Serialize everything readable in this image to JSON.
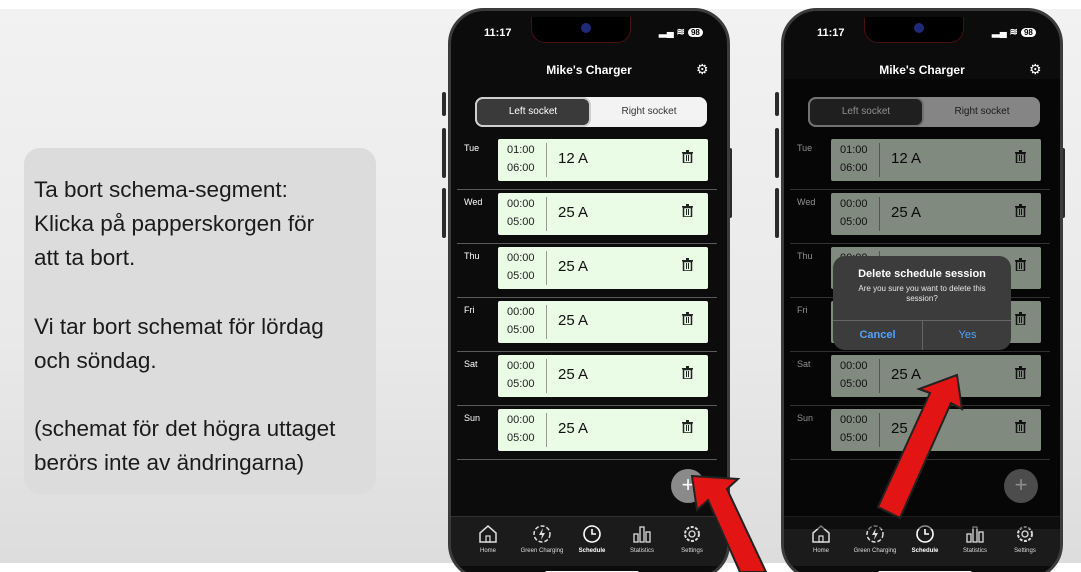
{
  "instructions": {
    "paragraphs": [
      "Ta bort schema-segment:\nKlicka på papperskorgen för\natt ta bort.",
      "Vi tar bort schemat för lördag\noch söndag.",
      "(schemat för det högra uttaget\nberörs inte av ändringarna)"
    ]
  },
  "status": {
    "time": "11:17",
    "battery": "98"
  },
  "app": {
    "title": "Mike's Charger",
    "tabs": {
      "left": "Left socket",
      "right": "Right socket"
    }
  },
  "schedule_left": [
    {
      "day": "Tue",
      "start": "01:00",
      "end": "06:00",
      "amps": "12 A"
    },
    {
      "day": "Wed",
      "start": "00:00",
      "end": "05:00",
      "amps": "25 A"
    },
    {
      "day": "Thu",
      "start": "00:00",
      "end": "05:00",
      "amps": "25 A"
    },
    {
      "day": "Fri",
      "start": "00:00",
      "end": "05:00",
      "amps": "25 A"
    },
    {
      "day": "Sat",
      "start": "00:00",
      "end": "05:00",
      "amps": "25 A"
    },
    {
      "day": "Sun",
      "start": "00:00",
      "end": "05:00",
      "amps": "25 A"
    }
  ],
  "schedule_right": [
    {
      "day": "Tue",
      "start": "01:00",
      "end": "06:00",
      "amps": "12 A"
    },
    {
      "day": "Wed",
      "start": "00:00",
      "end": "05:00",
      "amps": "25 A"
    },
    {
      "day": "Thu",
      "start": "00:00",
      "end": "",
      "amps": ""
    },
    {
      "day": "Fri",
      "start": "",
      "end": "",
      "amps": ""
    },
    {
      "day": "Sat",
      "start": "00:00",
      "end": "05:00",
      "amps": "25 A"
    },
    {
      "day": "Sun",
      "start": "00:00",
      "end": "05:00",
      "amps": "25"
    }
  ],
  "nav": {
    "home": "Home",
    "green": "Green Charging",
    "schedule": "Schedule",
    "statistics": "Statistics",
    "settings": "Settings"
  },
  "dialog": {
    "title": "Delete schedule session",
    "message": "Are you sure you want to delete this session?",
    "cancel": "Cancel",
    "yes": "Yes"
  },
  "icons": {
    "trash": "trash-icon",
    "add": "plus-icon",
    "settings_tune": "sliders-icon",
    "home": "home-icon",
    "green": "leaf-bolt-icon",
    "schedule": "clock-icon",
    "statistics": "bar-chart-icon",
    "settings": "gear-icon"
  },
  "colors": {
    "card": "#eafbe6",
    "dialog_button": "#4ea3ff",
    "arrow": "#e31414"
  }
}
